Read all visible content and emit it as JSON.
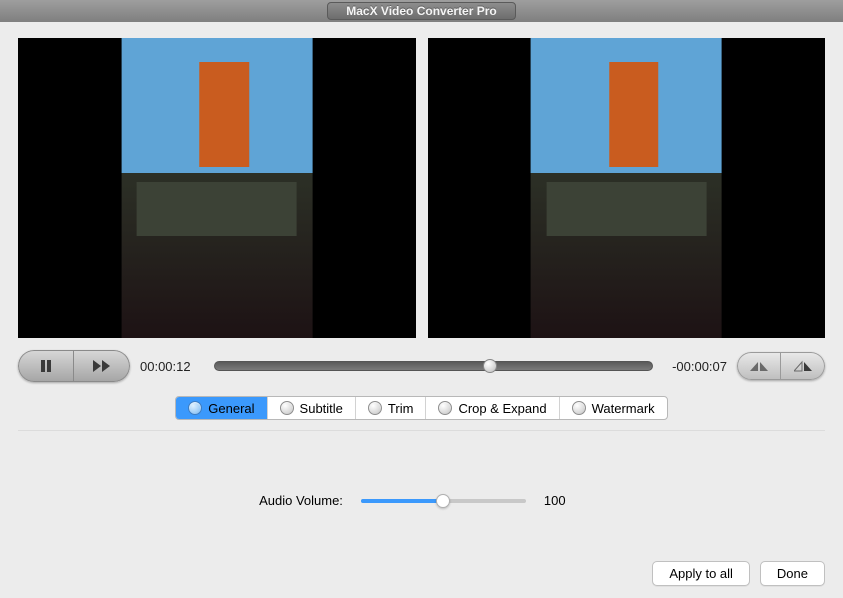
{
  "window": {
    "title": "MacX Video Converter Pro"
  },
  "transport": {
    "current_time": "00:00:12",
    "remaining_time": "-00:00:07",
    "progress_percent": 63
  },
  "tabs": [
    {
      "id": "general",
      "label": "General",
      "active": true
    },
    {
      "id": "subtitle",
      "label": "Subtitle",
      "active": false
    },
    {
      "id": "trim",
      "label": "Trim",
      "active": false
    },
    {
      "id": "crop",
      "label": "Crop & Expand",
      "active": false
    },
    {
      "id": "watermark",
      "label": "Watermark",
      "active": false
    }
  ],
  "general_panel": {
    "volume_label": "Audio Volume:",
    "volume_value": "100",
    "volume_percent": 50
  },
  "footer": {
    "apply_all": "Apply to all",
    "done": "Done"
  },
  "icons": {
    "pause": "pause-icon",
    "ff": "fast-forward-icon",
    "flip_h": "flip-horizontal-icon",
    "flip_v": "flip-vertical-icon"
  }
}
